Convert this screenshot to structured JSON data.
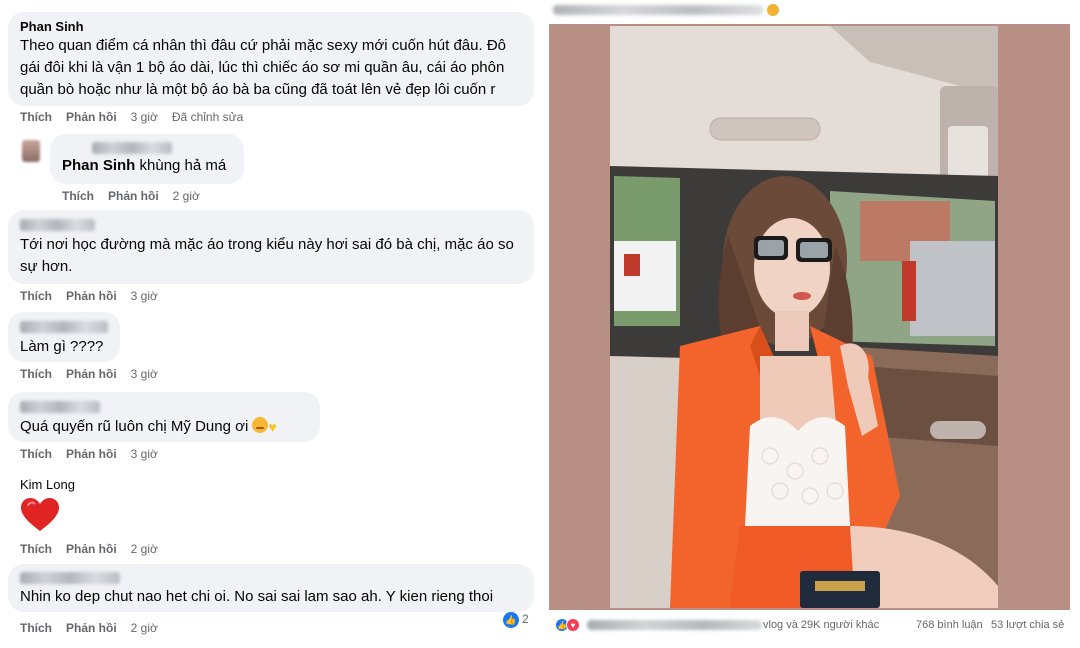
{
  "comments_panel": {
    "comments": [
      {
        "author": "Phan Sinh",
        "lines": [
          "Theo quan điểm cá nhân thì đâu cứ phải mặc sexy mới cuốn hút đâu. Đô",
          "gái đôi khi là vận 1 bộ áo dài, lúc thì chiếc áo sơ mi quần âu, cái áo phôn",
          "quần bò hoặc như là một bộ áo bà ba cũng đã toát lên vẻ đẹp lôi cuốn r"
        ],
        "actions": {
          "like": "Thích",
          "reply": "Phản hồi",
          "time": "3 giờ",
          "edited": "Đã chỉnh sửa"
        }
      },
      {
        "mention": "Phan Sinh",
        "text": " khùng hả má",
        "actions": {
          "like": "Thích",
          "reply": "Phản hồi",
          "time": "2 giờ"
        }
      },
      {
        "lines": [
          "Tới nơi học đường mà mặc áo trong kiểu này hơi sai đó bà chị, mặc áo so",
          "sự hơn."
        ],
        "actions": {
          "like": "Thích",
          "reply": "Phản hồi",
          "time": "3 giờ"
        }
      },
      {
        "text": "Làm gì ????",
        "actions": {
          "like": "Thích",
          "reply": "Phản hồi",
          "time": "3 giờ"
        }
      },
      {
        "text": "Quá quyến rũ luôn chị Mỹ Dung ơi ",
        "emojis": [
          "smiling-face-with-hearts-emoji",
          "yellow-heart-emoji"
        ],
        "actions": {
          "like": "Thích",
          "reply": "Phản hồi",
          "time": "3 giờ"
        }
      },
      {
        "author": "Kim Long",
        "sticker": "red-heart-emoji",
        "actions": {
          "like": "Thích",
          "reply": "Phản hồi",
          "time": "2 giờ"
        }
      },
      {
        "text": "Nhin ko dep chut nao het chi oi. No sai sai lam sao ah. Y kien rieng thoi",
        "reaction_count": "2",
        "actions": {
          "like": "Thích",
          "reply": "Phản hồi",
          "time": "2 giờ"
        }
      }
    ]
  },
  "post_panel": {
    "image_alt": "photo-of-woman-in-orange-blazer-in-car",
    "footer": {
      "reactions_text": "vlog và 29K người khác",
      "comments": "768 bình luận",
      "shares": "53 lượt chia sẻ"
    }
  },
  "colors": {
    "bubble_bg": "#f0f2f5",
    "meta_text": "#65676b",
    "like_blue": "#1877f2",
    "love_red": "#f33e58",
    "blazer_orange": "#f2642b"
  }
}
